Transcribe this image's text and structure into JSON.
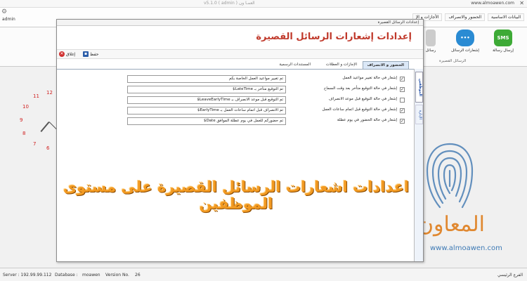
{
  "window": {
    "title": "v5.1.0 ( admin ) العمـا ون",
    "site": "www.almoawen.com",
    "close": "✕"
  },
  "menubar": {
    "user": "admin",
    "menus": [
      "البيانات الاساسية",
      "الحضور والانصراف",
      "الأجازات و الإ"
    ]
  },
  "ribbon": {
    "buttons": [
      {
        "label": "إرسال رسالة",
        "icon": "sms-icon",
        "icon_text": "SMS"
      },
      {
        "label": "إشعارات الرسائل",
        "icon": "chat-bubbles-icon",
        "icon_text": "•••"
      },
      {
        "label": "رسائل",
        "icon": "phone-icon",
        "icon_text": ""
      }
    ],
    "group_name": "الرسائل القصيرة"
  },
  "clock": {
    "numbers": [
      "12",
      "11",
      "10",
      "9",
      "8",
      "7",
      "6"
    ]
  },
  "dialog": {
    "title": "إعدادات الرسائل القصيرة",
    "header": "إعدادات  إشعارات  الرسائل  القصيرة",
    "toolbar": {
      "close": "إغلاق",
      "save": "حفظ"
    },
    "tabs": [
      "الحضور و الانصراف",
      "الإجازات و العطلات",
      "المستندات الرسمية"
    ],
    "vertical_tabs": [
      "الموظفين",
      "الإدارة"
    ],
    "rows": [
      {
        "checked": true,
        "label": "إشعار في حالة تغيير مواعيد العمل",
        "message": "تم تغيير مواعيد العمل الخاصة بكم"
      },
      {
        "checked": true,
        "label": "إشعار في حالة التوقيع متأخر بعد وقت السماح",
        "message": "تم التوقيع متأخر بـ LateTime$"
      },
      {
        "checked": false,
        "label": "إشعار في حالة التوقيع قبل موعد الانصراف",
        "message": "تم التوقيع قبل موعد الانصراف بـ LeaveEarlyTime$"
      },
      {
        "checked": true,
        "label": "إشعار في حالة التوقيع قبل اتمام ساعات العمل",
        "message": "تم الانصراف قبل اتمام ساعات العمل بـ EarlyTime$"
      },
      {
        "checked": true,
        "label": "إشعار في حالة الحضور في يوم عطلة",
        "message": "تم حضوركم للعمل في يوم عطلة الموافق Date$"
      }
    ],
    "overlay": "اعدادات اشعارات الرسائل القصيرة على مستوى الموظفين"
  },
  "watermark": {
    "brand": "المعاون",
    "url": "www.almoawen.com"
  },
  "status": {
    "server": "Server : 192.99.99.112",
    "database": "Database :",
    "db_name": "moawen",
    "version_label": "Version No.",
    "version": "26",
    "branch": "الفرع الرئيسي"
  },
  "colors": {
    "accent": "#c0392b",
    "overlay": "#f29a22",
    "sms": "#3daa36",
    "url": "#3e7ab5"
  }
}
